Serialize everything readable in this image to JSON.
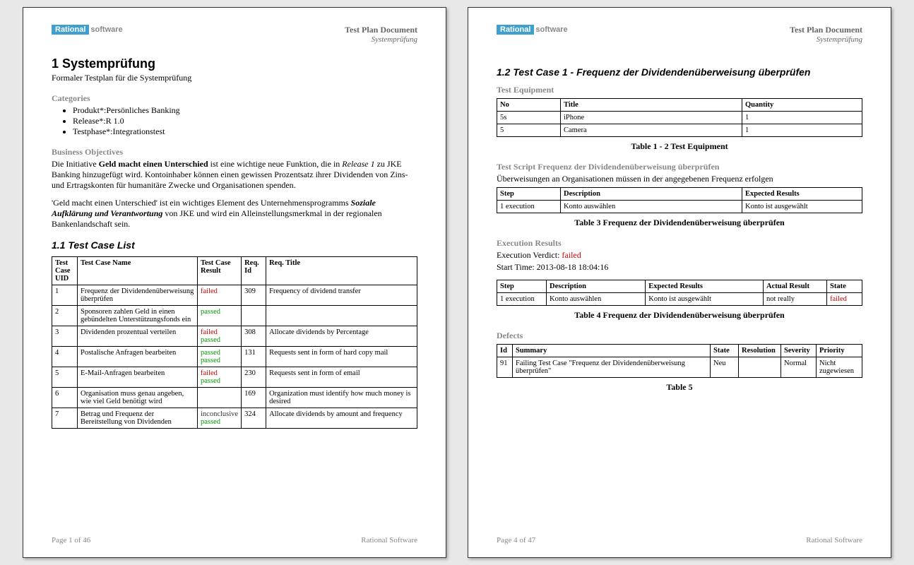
{
  "header": {
    "logo_left": "Rational",
    "logo_right": "software",
    "doc_title": "Test Plan Document",
    "doc_sub": "Systemprüfung"
  },
  "page1": {
    "h1": "1  Systemprüfung",
    "subtitle": "Formaler Testplan für die Systemprüfung",
    "categories_title": "Categories",
    "categories": [
      "Produkt*:Persönliches Banking",
      "Release*:R 1.0",
      "Testphase*:Integrationstest"
    ],
    "bo_title": "Business Objectives",
    "bo_p1_a": "Die Initiative ",
    "bo_p1_b": "Geld macht einen Unterschied",
    "bo_p1_c": " ist eine wichtige neue Funktion, die in ",
    "bo_p1_d": "Release 1",
    "bo_p1_e": " zu JKE Banking hinzugefügt wird. Kontoinhaber können einen gewissen Prozentsatz ihrer Dividenden von Zins- und Ertragskonten für humanitäre Zwecke und Organisationen spenden.",
    "bo_p2_a": "'Geld macht einen Unterschied' ist ein wichtiges Element des Unternehmensprogramms ",
    "bo_p2_b": "Soziale Aufklärung und Verantwortung",
    "bo_p2_c": " von JKE und wird ein Alleinstellungsmerkmal in der regionalen Bankenlandschaft sein.",
    "h2": "1.1  Test Case List",
    "table_headers": [
      "Test Case UID",
      "Test Case Name",
      "Test Case Result",
      "Req. Id",
      "Req. Title"
    ],
    "rows": [
      {
        "uid": "1",
        "name": "Frequenz der Dividendenüberweisung überprüfen",
        "results": [
          "failed"
        ],
        "req": "309",
        "title": "Frequency of dividend transfer"
      },
      {
        "uid": "2",
        "name": "Sponsoren zahlen Geld in einen gebündelten Unterstützungsfonds ein",
        "results": [
          "passed"
        ],
        "req": "",
        "title": ""
      },
      {
        "uid": "3",
        "name": "Dividenden prozentual verteilen",
        "results": [
          "failed",
          "passed"
        ],
        "req": "308",
        "title": "Allocate dividends by Percentage"
      },
      {
        "uid": "4",
        "name": "Postalische Anfragen bearbeiten",
        "results": [
          "passed",
          "passed"
        ],
        "req": "131",
        "title": "Requests sent in form of hard copy mail"
      },
      {
        "uid": "5",
        "name": "E-Mail-Anfragen bearbeiten",
        "results": [
          "failed",
          "passed"
        ],
        "req": "230",
        "title": "Requests sent in form of email"
      },
      {
        "uid": "6",
        "name": "Organisation muss genau angeben, wie viel Geld benötigt wird",
        "results": [],
        "req": "169",
        "title": "Organization must identify how much money is desired"
      },
      {
        "uid": "7",
        "name": "Betrag und Frequenz der Bereitstellung von Dividenden",
        "results": [
          "inconclusive",
          "passed"
        ],
        "req": "324",
        "title": "Allocate dividends by amount and frequency"
      }
    ],
    "footer_left": "Page 1 of  46",
    "footer_right": "Rational Software"
  },
  "page2": {
    "h2": "1.2  Test Case 1 - Frequenz der Dividendenüberweisung überprüfen",
    "te_title": "Test Equipment",
    "te_headers": [
      "No",
      "Title",
      "Quantity"
    ],
    "te_rows": [
      {
        "no": "5s",
        "title": "iPhone",
        "qty": "1"
      },
      {
        "no": "5",
        "title": "Camera",
        "qty": "1"
      }
    ],
    "te_caption": "Table 1 - 2 Test Equipment",
    "ts_title": "Test Script Frequenz der Dividendenüberweisung überprüfen",
    "ts_desc": "Überweisungen an Organisationen müssen in der angegebenen Frequenz erfolgen",
    "ts_headers": [
      "Step",
      "Description",
      "Expected Results"
    ],
    "ts_rows": [
      {
        "step": "1 execution",
        "desc": "Konto auswählen",
        "exp": "Konto ist ausgewählt"
      }
    ],
    "ts_caption": "Table 3 Frequenz der Dividendenüberweisung überprüfen",
    "er_title": "Execution Results",
    "er_verdict_label": "Execution Verdict: ",
    "er_verdict": "failed",
    "er_start": "Start Time: 2013-08-18 18:04:16",
    "er_headers": [
      "Step",
      "Description",
      "Expected Results",
      "Actual Result",
      "State"
    ],
    "er_rows": [
      {
        "step": "1 execution",
        "desc": "Konto auswählen",
        "exp": "Konto ist ausgewählt",
        "act": "not really",
        "state": "failed"
      }
    ],
    "er_caption": "Table 4 Frequenz der Dividendenüberweisung überprüfen",
    "def_title": "Defects",
    "def_headers": [
      "Id",
      "Summary",
      "State",
      "Resolution",
      "Severity",
      "Priority"
    ],
    "def_rows": [
      {
        "id": "91",
        "summary": "Failing Test Case \"Frequenz der Dividendenüberweisung überprüfen\"",
        "state": "Neu",
        "res": "",
        "sev": "Normal",
        "pri": "Nicht zugewiesen"
      }
    ],
    "def_caption": "Table 5",
    "footer_left": "Page 4 of  47",
    "footer_right": "Rational Software"
  }
}
